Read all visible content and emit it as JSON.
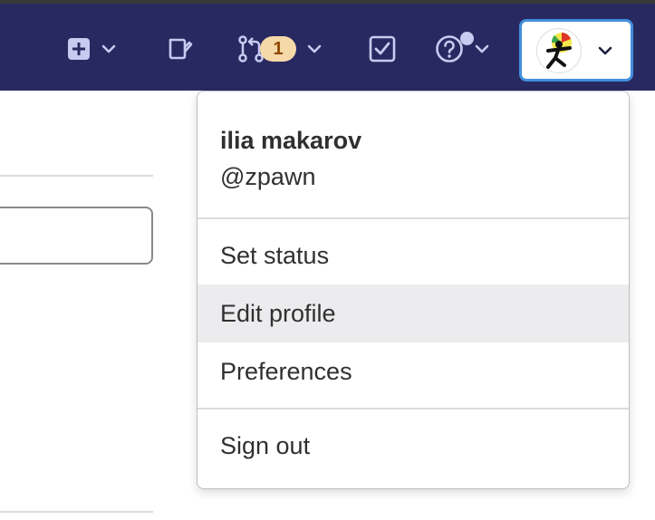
{
  "header": {
    "merge_requests_count": "1"
  },
  "user": {
    "name": "ilia makarov",
    "username": "@zpawn"
  },
  "menu": {
    "set_status": "Set status",
    "edit_profile": "Edit profile",
    "preferences": "Preferences",
    "sign_out": "Sign out"
  },
  "icons": {
    "create": "plus-square-icon",
    "issues": "issues-icon",
    "merge_requests": "merge-request-icon",
    "todos": "todo-check-icon",
    "help": "question-circle-icon",
    "chevron": "chevron-down-icon"
  },
  "colors": {
    "header_bg": "#292961",
    "icon": "#c7cbf0",
    "badge_bg": "#f5d9a8",
    "badge_text": "#8f4700",
    "avatar_focus": "#428fdc",
    "hover_item": "#ececef"
  }
}
